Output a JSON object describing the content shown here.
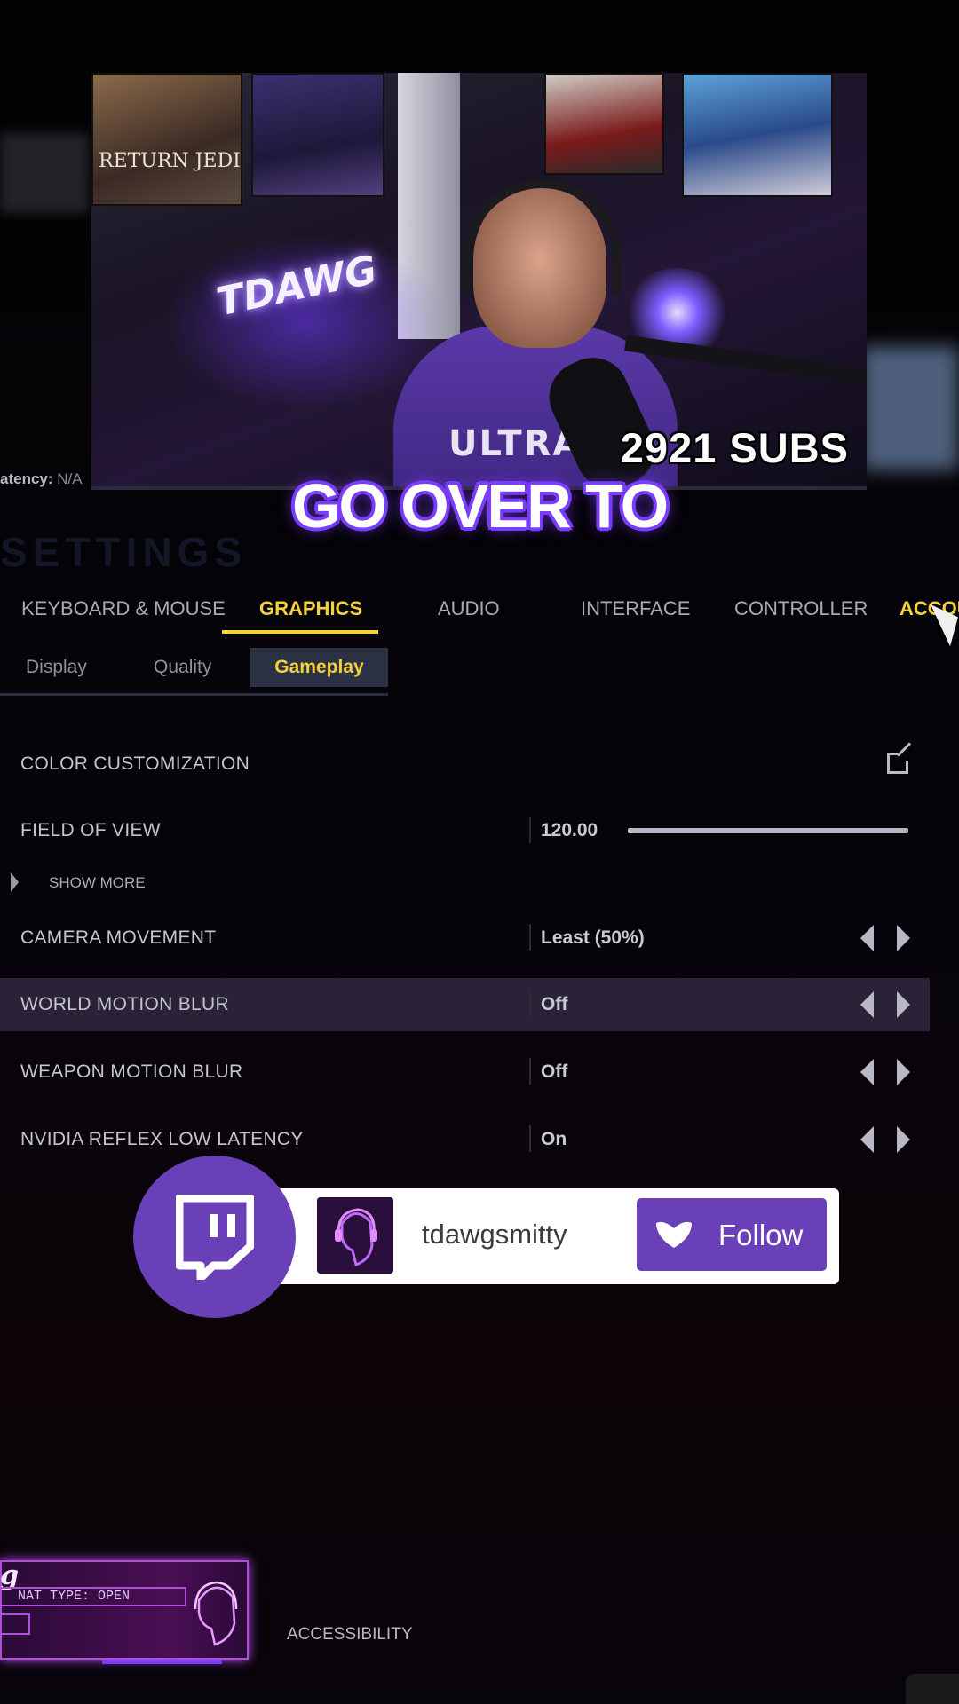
{
  "hud": {
    "latency_label": "atency:",
    "latency_value": "N/A"
  },
  "webcam": {
    "sub_count": "2921 SUBS",
    "neon_sign": "TDAWG",
    "poster_text": "RETURN JEDI",
    "hoodie_text": "ULTRA"
  },
  "caption": "GO OVER TO",
  "settings": {
    "title": "SETTINGS",
    "tabs": [
      "KEYBOARD & MOUSE",
      "GRAPHICS",
      "AUDIO",
      "INTERFACE",
      "CONTROLLER",
      "ACCOUN"
    ],
    "active_tab": "GRAPHICS",
    "subtabs": [
      "Display",
      "Quality",
      "Gameplay"
    ],
    "active_subtab": "Gameplay",
    "rows": {
      "color_customization": {
        "label": "COLOR CUSTOMIZATION"
      },
      "field_of_view": {
        "label": "FIELD OF VIEW",
        "value": "120.00"
      },
      "show_more": "SHOW MORE",
      "camera_movement": {
        "label": "CAMERA MOVEMENT",
        "value": "Least (50%)"
      },
      "world_motion_blur": {
        "label": "WORLD MOTION BLUR",
        "value": "Off"
      },
      "weapon_motion_blur": {
        "label": "WEAPON MOTION BLUR",
        "value": "Off"
      },
      "nvidia_reflex": {
        "label": "NVIDIA REFLEX LOW LATENCY",
        "value": "On"
      }
    },
    "accessibility": "ACCESSIBILITY"
  },
  "twitch": {
    "username": "tdawgsmitty",
    "follow_label": "Follow",
    "brand_color": "#6a40b8"
  },
  "overlay": {
    "tag": "g",
    "nat_type": "NAT TYPE: OPEN"
  },
  "colors": {
    "accent_yellow": "#f3d23a",
    "highlight_row": "#2a2237",
    "caption_outline": "#7a3cff"
  }
}
